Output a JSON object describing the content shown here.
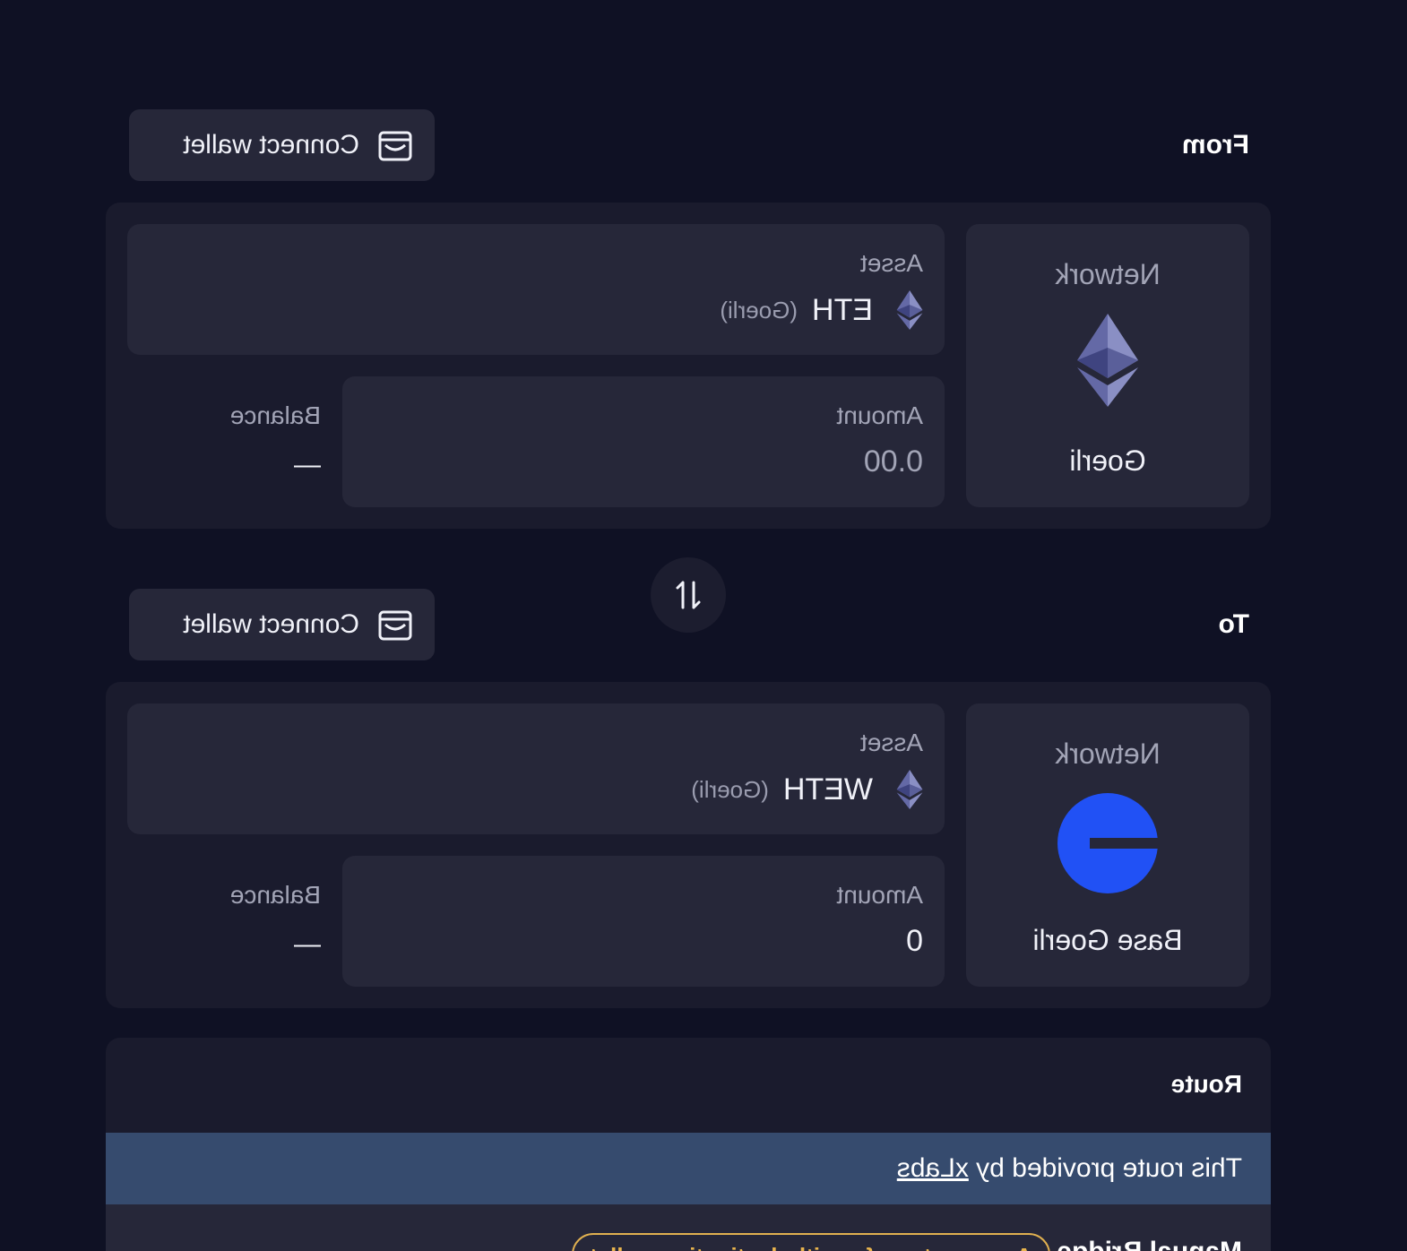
{
  "from": {
    "title": "From",
    "connect_label": "Connect wallet",
    "network": {
      "label": "Network",
      "name": "Goerli",
      "icon": "ethereum-icon"
    },
    "asset": {
      "label": "Asset",
      "symbol": "ETH",
      "network": "(Goerli)",
      "icon": "ethereum-icon"
    },
    "amount": {
      "label": "Amount",
      "placeholder": "0.00"
    },
    "balance": {
      "label": "Balance",
      "value": "—"
    }
  },
  "swap": {
    "icon": "swap-arrows-icon"
  },
  "to": {
    "title": "To",
    "connect_label": "Connect wallet",
    "network": {
      "label": "Network",
      "name": "Base Goerli",
      "icon": "base-icon",
      "icon_color": "#2151f5"
    },
    "asset": {
      "label": "Asset",
      "symbol": "WETH",
      "network": "(Goerli)",
      "icon": "ethereum-icon"
    },
    "amount": {
      "label": "Amount",
      "value": "0"
    },
    "balance": {
      "label": "Balance",
      "value": "—"
    }
  },
  "route": {
    "title": "Route",
    "info_text": "This route provided by",
    "info_link": "xLabs",
    "item_name": "Manual Bridge",
    "item_badge": "Approve transfer with destination wallet"
  },
  "colors": {
    "background": "#0f1124",
    "panel": "#1a1b2d",
    "card": "#262739",
    "info_banner": "#364b6e",
    "badge": "#e8b44d",
    "base_blue": "#2151f5"
  }
}
